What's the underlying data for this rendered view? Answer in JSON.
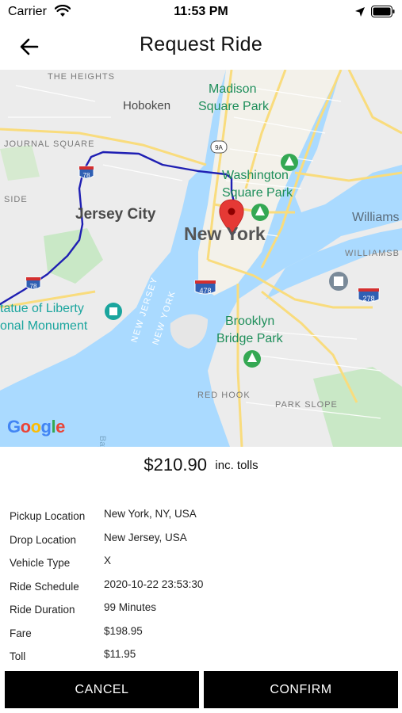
{
  "status_bar": {
    "carrier": "Carrier",
    "time": "11:53 PM"
  },
  "header": {
    "title": "Request Ride",
    "back_icon": "arrow-left-icon"
  },
  "map": {
    "labels": {
      "the_heights": "THE HEIGHTS",
      "hoboken": "Hoboken",
      "madison_square_park_1": "Madison",
      "madison_square_park_2": "Square Park",
      "journal_square": "JOURNAL SQUARE",
      "washington_square_1": "Washington",
      "washington_square_2": "Square Park",
      "side": "SIDE",
      "jersey_city": "Jersey City",
      "new_york": "New York",
      "williams": "Williams",
      "williamsb": "WILLIAMSB",
      "statue_1": "tatue of Liberty",
      "statue_2": "onal Monument",
      "new_jersey": "NEW JERSEY",
      "new_york_water": "NEW YORK",
      "brooklyn_bridge_1": "Brooklyn",
      "brooklyn_bridge_2": "Bridge Park",
      "red_hook": "RED HOOK",
      "park_slope": "PARK SLOPE",
      "bay": "Bay",
      "shield_78_a": "78",
      "shield_78_b": "78",
      "shield_9a": "9A",
      "shield_478": "478",
      "shield_278": "278"
    },
    "route_color": "#1f1fb3",
    "pin_color": "#e53935",
    "google_logo": "Google"
  },
  "price": {
    "amount": "$210.90",
    "note": "inc. tolls"
  },
  "details": [
    {
      "label": "Pickup Location",
      "value": "New York, NY, USA"
    },
    {
      "label": "Drop Location",
      "value": "New Jersey, USA"
    },
    {
      "label": "Vehicle Type",
      "value": "X"
    },
    {
      "label": "Ride Schedule",
      "value": "2020-10-22 23:53:30"
    },
    {
      "label": "Ride Duration",
      "value": "99 Minutes"
    },
    {
      "label": "Fare",
      "value": "$198.95"
    },
    {
      "label": "Toll",
      "value": "$11.95"
    }
  ],
  "buttons": {
    "cancel": "CANCEL",
    "confirm": "CONFIRM"
  }
}
